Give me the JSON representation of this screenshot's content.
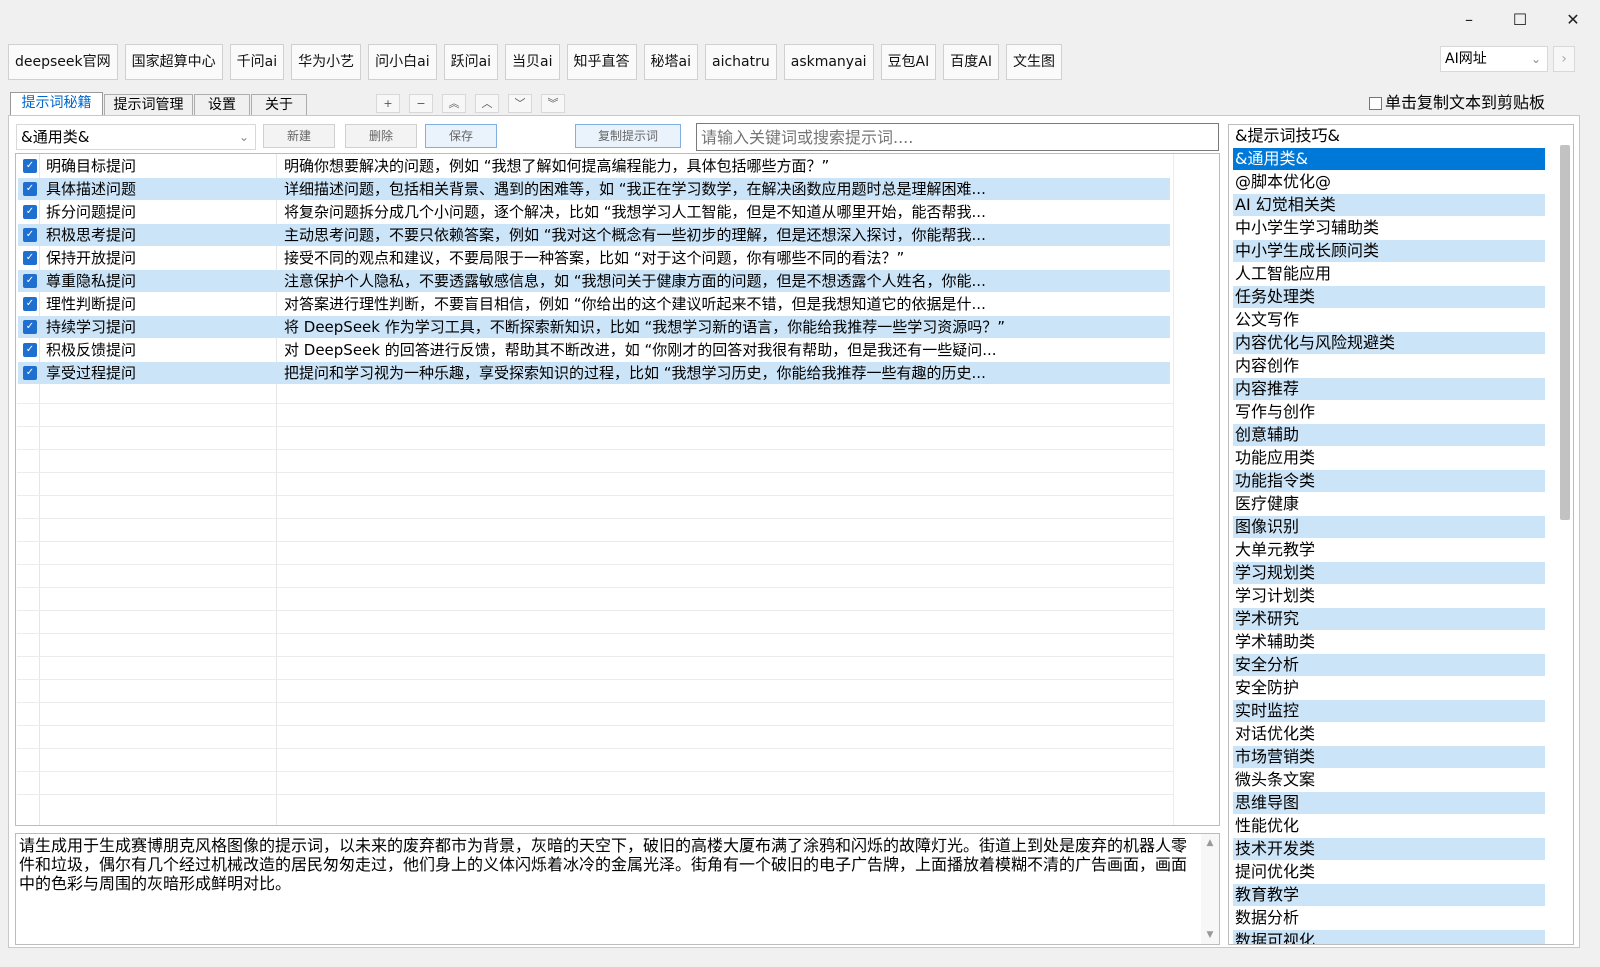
{
  "window_controls": {
    "minimize": "–",
    "maximize": "☐",
    "close": "✕"
  },
  "sites": [
    "deepseek官网",
    "国家超算中心",
    "千问ai",
    "华为小艺",
    "问小白ai",
    "跃问ai",
    "当贝ai",
    "知乎直答",
    "秘塔ai",
    "aichatru",
    "askmanyai",
    "豆包AI",
    "百度AI",
    "文生图"
  ],
  "site_dropdown": {
    "value": "AI网址",
    "arrow": "⌄"
  },
  "nav_arrow": "›",
  "tabs": [
    "提示词秘籍",
    "提示词管理",
    "设置",
    "关于"
  ],
  "order_buttons": [
    "+",
    "−",
    "︽",
    "︿",
    "﹀",
    "︾"
  ],
  "copy_checkbox_label": "单击复制文本到剪贴板",
  "category_select": "&通用类&",
  "buttons": {
    "new": "新建",
    "delete": "删除",
    "save": "保存",
    "copy_prompt": "复制提示词"
  },
  "search_placeholder": "请输入关键词或搜索提示词....",
  "rows": [
    {
      "name": "明确目标提问",
      "desc": "明确你想要解决的问题，例如 “我想了解如何提高编程能力，具体包括哪些方面？”"
    },
    {
      "name": "具体描述问题",
      "desc": "详细描述问题，包括相关背景、遇到的困难等，如 “我正在学习数学，在解决函数应用题时总是理解困难..."
    },
    {
      "name": "拆分问题提问",
      "desc": "将复杂问题拆分成几个小问题，逐个解决，比如 “我想学习人工智能，但是不知道从哪里开始，能否帮我..."
    },
    {
      "name": "积极思考提问",
      "desc": "主动思考问题，不要只依赖答案，例如 “我对这个概念有一些初步的理解，但是还想深入探讨，你能帮我..."
    },
    {
      "name": "保持开放提问",
      "desc": "接受不同的观点和建议，不要局限于一种答案，比如 “对于这个问题，你有哪些不同的看法？”"
    },
    {
      "name": "尊重隐私提问",
      "desc": "注意保护个人隐私，不要透露敏感信息，如 “我想问关于健康方面的问题，但是不想透露个人姓名，你能..."
    },
    {
      "name": "理性判断提问",
      "desc": "对答案进行理性判断，不要盲目相信，例如 “你给出的这个建议听起来不错，但是我想知道它的依据是什..."
    },
    {
      "name": "持续学习提问",
      "desc": "将 DeepSeek 作为学习工具，不断探索新知识，比如 “我想学习新的语言，你能给我推荐一些学习资源吗？”"
    },
    {
      "name": "积极反馈提问",
      "desc": "对 DeepSeek 的回答进行反馈，帮助其不断改进，如 “你刚才的回答对我很有帮助，但是我还有一些疑问..."
    },
    {
      "name": "享受过程提问",
      "desc": "把提问和学习视为一种乐趣，享受探索知识的过程，比如 “我想学习历史，你能给我推荐一些有趣的历史..."
    }
  ],
  "prompt_text": "请生成用于生成赛博朋克风格图像的提示词，以未来的废弃都市为背景，灰暗的天空下，破旧的高楼大厦布满了涂鸦和闪烁的故障灯光。街道上到处是废弃的机器人零件和垃圾，偶尔有几个经过机械改造的居民匆匆走过，他们身上的义体闪烁着冰冷的金属光泽。街角有一个破旧的电子广告牌，上面播放着模糊不清的广告画面，画面中的色彩与周围的灰暗形成鲜明对比。",
  "categories": [
    "&提示词技巧&",
    "&通用类&",
    "@脚本优化@",
    "AI 幻觉相关类",
    "中小学生学习辅助类",
    "中小学生成长顾问类",
    "人工智能应用",
    "任务处理类",
    "公文写作",
    "内容优化与风险规避类",
    "内容创作",
    "内容推荐",
    "写作与创作",
    "创意辅助",
    "功能应用类",
    "功能指令类",
    "医疗健康",
    "图像识别",
    "大单元教学",
    "学习规划类",
    "学习计划类",
    "学术研究",
    "学术辅助类",
    "安全分析",
    "安全防护",
    "实时监控",
    "对话优化类",
    "市场营销类",
    "微头条文案",
    "思维导图",
    "性能优化",
    "技术开发类",
    "提问优化类",
    "教育教学",
    "数据分析",
    "数据可视化"
  ],
  "colors": {
    "accent": "#0078d7",
    "row_highlight": "#cce4f7",
    "checkbox": "#1e6fd0"
  }
}
